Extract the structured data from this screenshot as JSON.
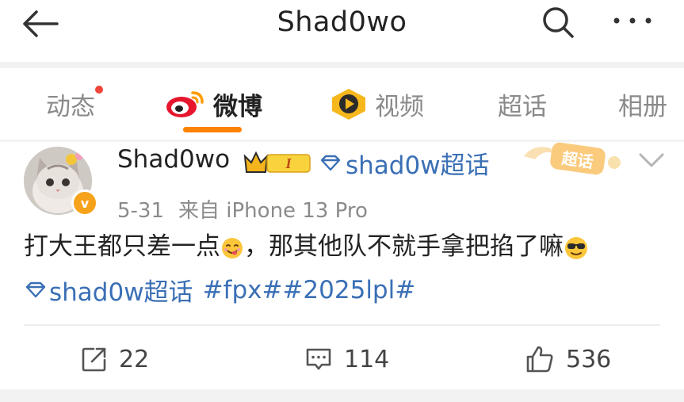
{
  "header": {
    "title": "Shad0wo",
    "back_icon": "arrow-left-icon",
    "search_icon": "search-icon",
    "more_icon": "more-dots-icon"
  },
  "tabs": [
    {
      "label": "动态",
      "has_dot": true
    },
    {
      "label": "微博",
      "active": true,
      "icon": "weibo-logo-icon"
    },
    {
      "label": "视频",
      "icon": "video-play-icon"
    },
    {
      "label": "超话"
    },
    {
      "label": "相册"
    }
  ],
  "post": {
    "author": "Shad0wo",
    "vip_level": "I",
    "verified_mark": "v",
    "topic": "shad0w超话",
    "sticker_label": "超话",
    "date": "5-31",
    "source": "来自 iPhone 13 Pro",
    "text_part1": "打大王都只差一点",
    "text_part2": "，那其他队不就手拿把掐了嘛",
    "topic_inline": "shad0w超话",
    "hashtags": "#fpx##2025lpl#",
    "colors": {
      "accent": "#ff8200",
      "link": "#3a6fb5",
      "badge": "#f7a21b"
    }
  },
  "actions": {
    "repost_count": "22",
    "comment_count": "114",
    "like_count": "536"
  }
}
